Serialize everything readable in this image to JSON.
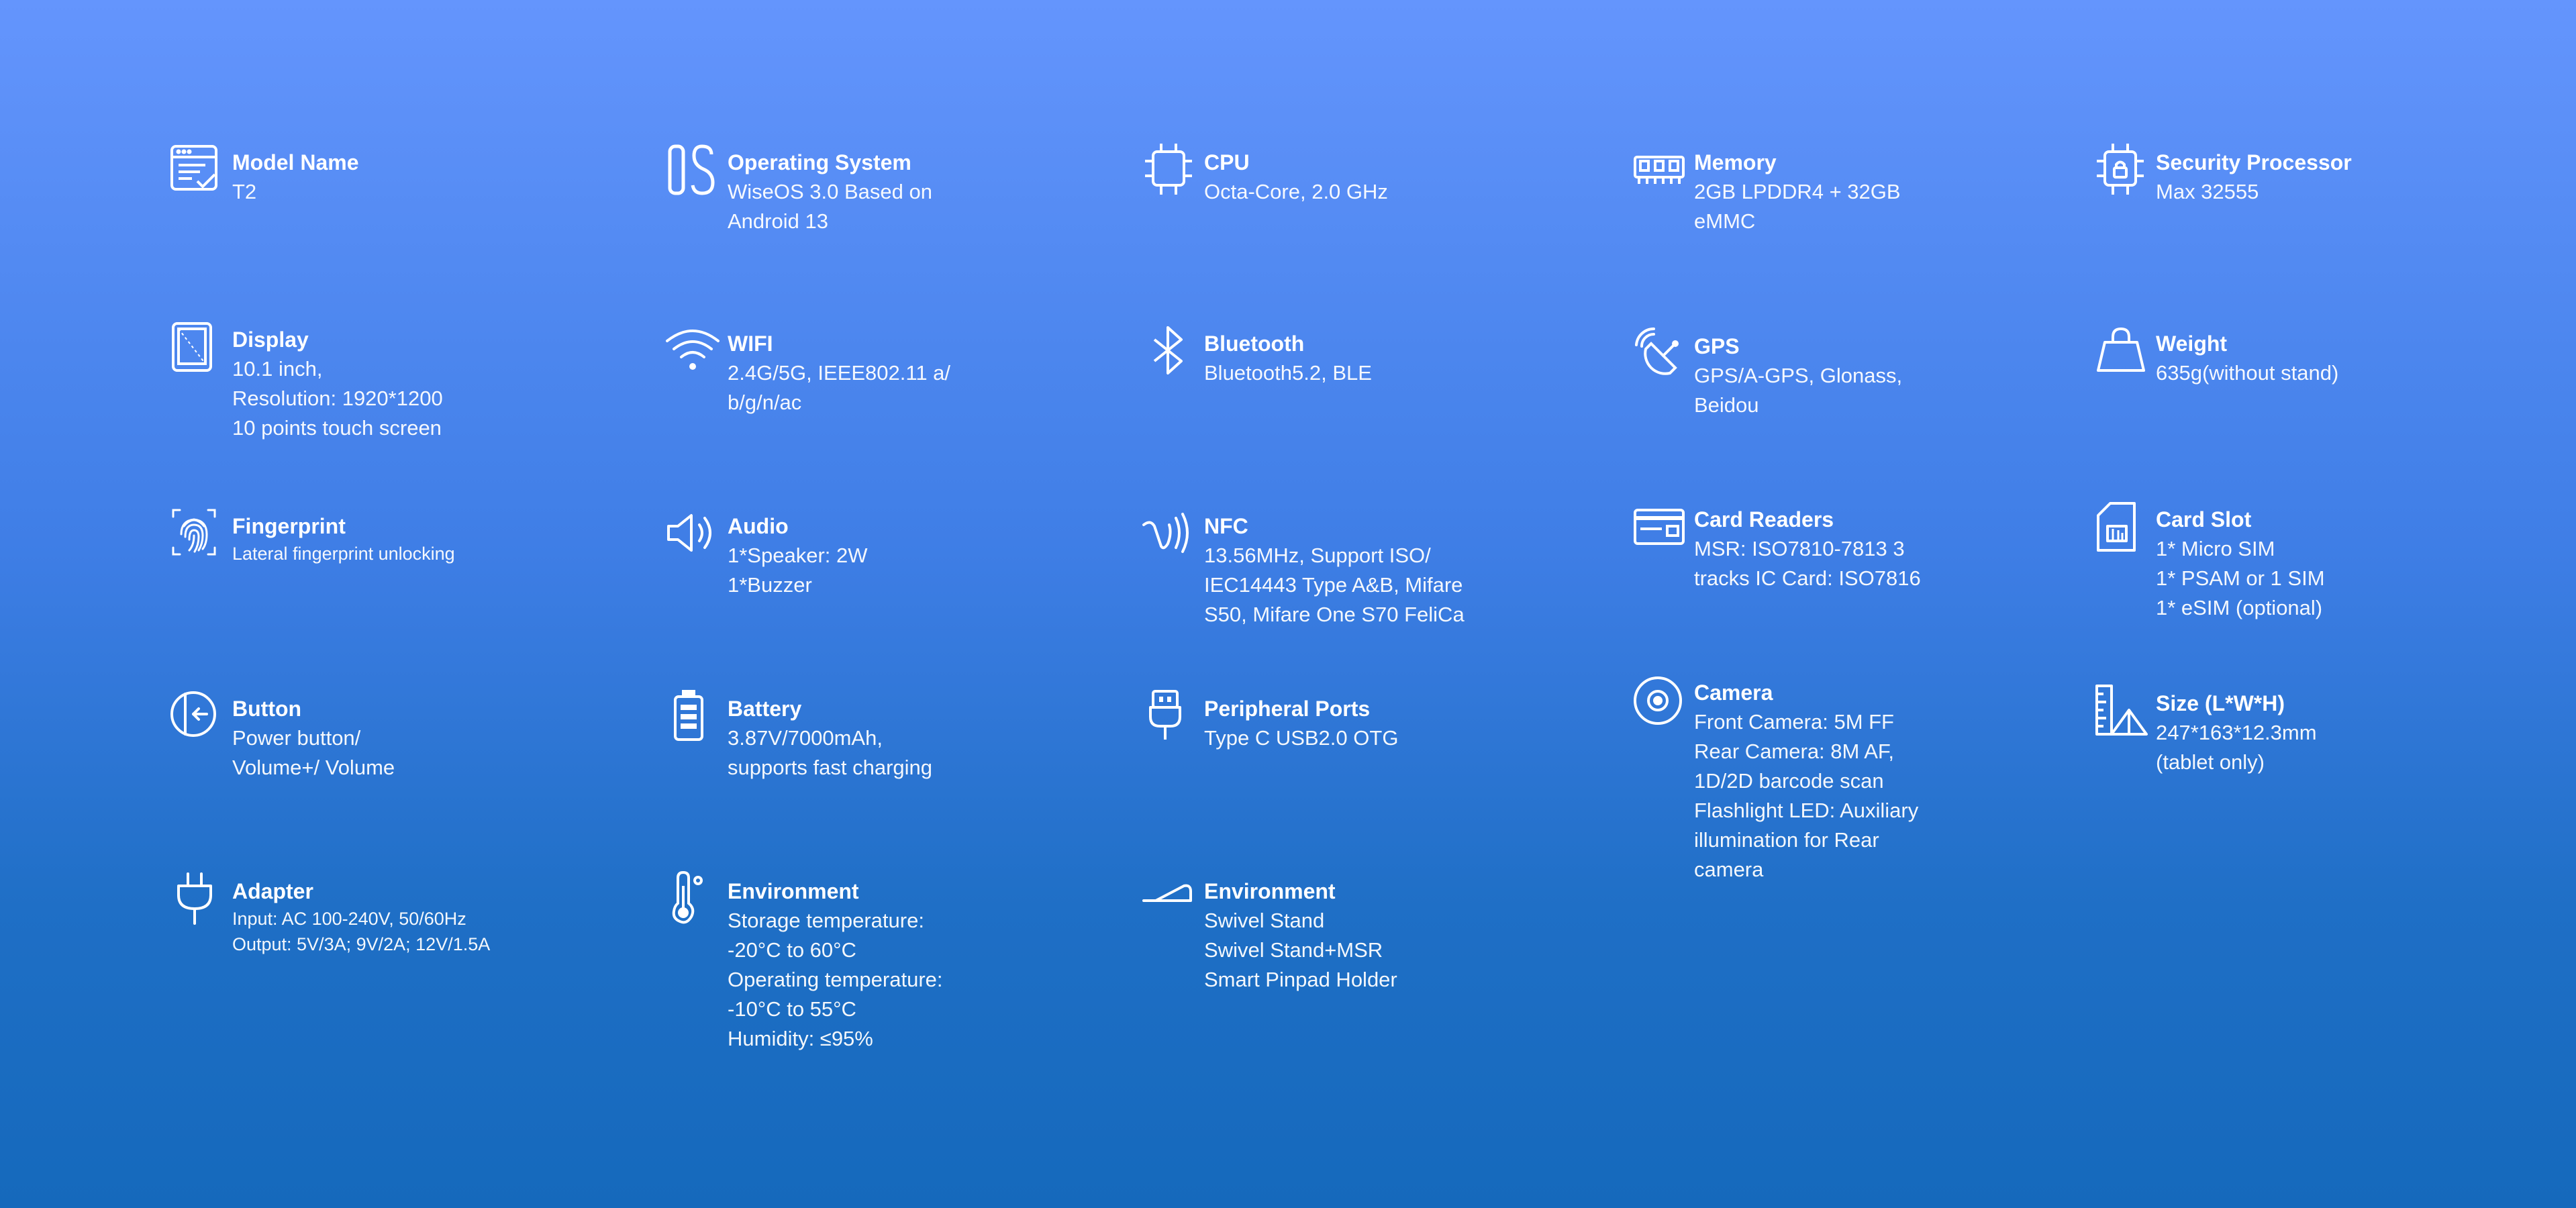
{
  "background": {
    "top": "#6495fd",
    "bottom": "#1569bc"
  },
  "specs": [
    {
      "icon": "model-name-icon",
      "title": "Model Name",
      "lines": [
        "T2"
      ]
    },
    {
      "icon": "operating-system-icon",
      "title": "Operating System",
      "lines": [
        "WiseOS 3.0 Based on",
        "Android 13"
      ]
    },
    {
      "icon": "cpu-icon",
      "title": "CPU",
      "lines": [
        "Octa-Core, 2.0 GHz"
      ]
    },
    {
      "icon": "memory-icon",
      "title": "Memory",
      "lines": [
        "2GB LPDDR4 + 32GB",
        "eMMC"
      ]
    },
    {
      "icon": "security-processor-icon",
      "title": "Security Processor",
      "lines": [
        "Max 32555"
      ]
    },
    {
      "icon": "display-icon",
      "title": "Display",
      "lines": [
        "10.1 inch,",
        "Resolution: 1920*1200",
        "10 points touch screen"
      ]
    },
    {
      "icon": "wifi-icon",
      "title": "WIFI",
      "lines": [
        "2.4G/5G, IEEE802.11 a/",
        "b/g/n/ac"
      ]
    },
    {
      "icon": "bluetooth-icon",
      "title": "Bluetooth",
      "lines": [
        "Bluetooth5.2, BLE"
      ]
    },
    {
      "icon": "gps-icon",
      "title": "GPS",
      "lines": [
        "GPS/A-GPS, Glonass,",
        "Beidou"
      ]
    },
    {
      "icon": "weight-icon",
      "title": "Weight",
      "lines": [
        "635g(without stand)"
      ]
    },
    {
      "icon": "fingerprint-icon",
      "title": "Fingerprint",
      "lines": [
        "Lateral fingerprint unlocking"
      ]
    },
    {
      "icon": "audio-icon",
      "title": "Audio",
      "lines": [
        "1*Speaker: 2W",
        "1*Buzzer"
      ]
    },
    {
      "icon": "nfc-icon",
      "title": "NFC",
      "lines": [
        "13.56MHz, Support ISO/",
        "IEC14443 Type A&B, Mifare",
        "S50, Mifare One S70 FeliCa"
      ]
    },
    {
      "icon": "card-readers-icon",
      "title": "Card Readers",
      "lines": [
        "MSR: ISO7810-7813 3",
        "tracks IC Card: ISO7816"
      ]
    },
    {
      "icon": "card-slot-icon",
      "title": "Card Slot",
      "lines": [
        "1* Micro SIM",
        "1* PSAM or 1 SIM",
        "1* eSIM (optional)"
      ]
    },
    {
      "icon": "button-icon",
      "title": "Button",
      "lines": [
        "Power button/",
        "Volume+/ Volume"
      ]
    },
    {
      "icon": "battery-icon",
      "title": "Battery",
      "lines": [
        "3.87V/7000mAh,",
        "supports fast charging"
      ]
    },
    {
      "icon": "peripheral-ports-icon",
      "title": "Peripheral Ports",
      "lines": [
        "Type C USB2.0 OTG"
      ]
    },
    {
      "icon": "camera-icon",
      "title": "Camera",
      "lines": [
        "Front Camera: 5M FF",
        "Rear Camera: 8M AF,",
        "1D/2D barcode scan",
        "Flashlight LED: Auxiliary",
        "illumination for Rear",
        "camera"
      ]
    },
    {
      "icon": "size-icon",
      "title": "Size (L*W*H)",
      "lines": [
        "247*163*12.3mm",
        "(tablet only)"
      ]
    },
    {
      "icon": "adapter-icon",
      "title": "Adapter",
      "lines": [
        "Input: AC 100-240V, 50/60Hz",
        "Output: 5V/3A; 9V/2A; 12V/1.5A"
      ]
    },
    {
      "icon": "thermometer-icon",
      "title": "Environment",
      "lines": [
        "Storage temperature:",
        "-20°C to 60°C",
        "Operating temperature:",
        "-10°C to 55°C",
        "Humidity: ≤95%"
      ]
    },
    {
      "icon": "stand-icon",
      "title": "Environment",
      "lines": [
        "Swivel Stand",
        "Swivel Stand+MSR",
        "Smart Pinpad Holder"
      ]
    }
  ]
}
